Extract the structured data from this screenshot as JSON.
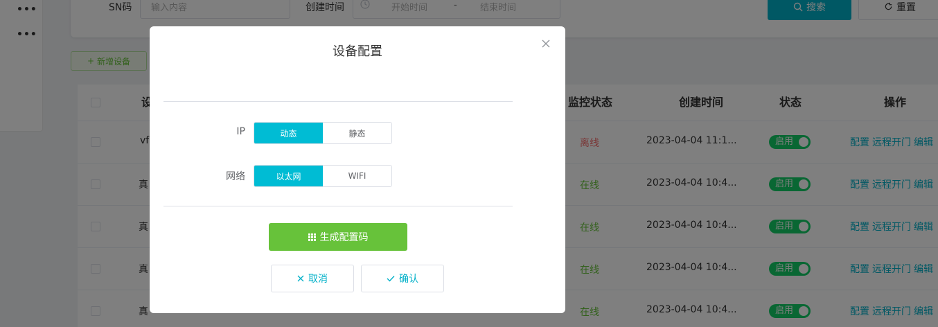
{
  "rail": {
    "more1": "•••",
    "more2": "•••"
  },
  "search": {
    "sn_label": "SN码",
    "sn_placeholder": "输入内容",
    "created_label": "创建时间",
    "start_placeholder": "开始时间",
    "range_sep": "-",
    "end_placeholder": "结束时间",
    "search_btn": "搜索",
    "reset_btn": "重置"
  },
  "toolbar": {
    "add_btn": "新增设备"
  },
  "table": {
    "headers": {
      "name_partial": "设",
      "monitor": "监控状态",
      "created": "创建时间",
      "status": "状态",
      "ops": "操作"
    },
    "rows": [
      {
        "name": "vf",
        "monitor": "离线",
        "monitor_state": "offline",
        "created": "2023-04-04 11:1...",
        "switch": "启用"
      },
      {
        "name": "真",
        "monitor": "在线",
        "monitor_state": "online",
        "created": "2023-04-04 10:4...",
        "switch": "启用"
      },
      {
        "name": "真",
        "monitor": "在线",
        "monitor_state": "online",
        "created": "2023-04-04 10:4...",
        "switch": "启用"
      },
      {
        "name": "真",
        "monitor": "在线",
        "monitor_state": "online",
        "created": "2023-04-04 10:4...",
        "switch": "启用"
      },
      {
        "name": "真",
        "monitor": "在线",
        "monitor_state": "online",
        "created": "2023-04-04 10:4...",
        "switch": "启用"
      }
    ],
    "ops": {
      "config": "配置",
      "remote_open": "远程开门",
      "edit": "编辑"
    }
  },
  "dialog": {
    "title": "设备配置",
    "ip_label": "IP",
    "ip_options": [
      "动态",
      "静态"
    ],
    "ip_selected": "动态",
    "network_label": "网络",
    "network_options": [
      "以太网",
      "WIFI"
    ],
    "network_selected": "以太网",
    "generate_btn": "生成配置码",
    "cancel_btn": "取消",
    "confirm_btn": "确认"
  },
  "colors": {
    "accent": "#00bcd4",
    "success": "#67c23a",
    "danger": "#f56c6c",
    "switch_on": "#13ce66"
  }
}
